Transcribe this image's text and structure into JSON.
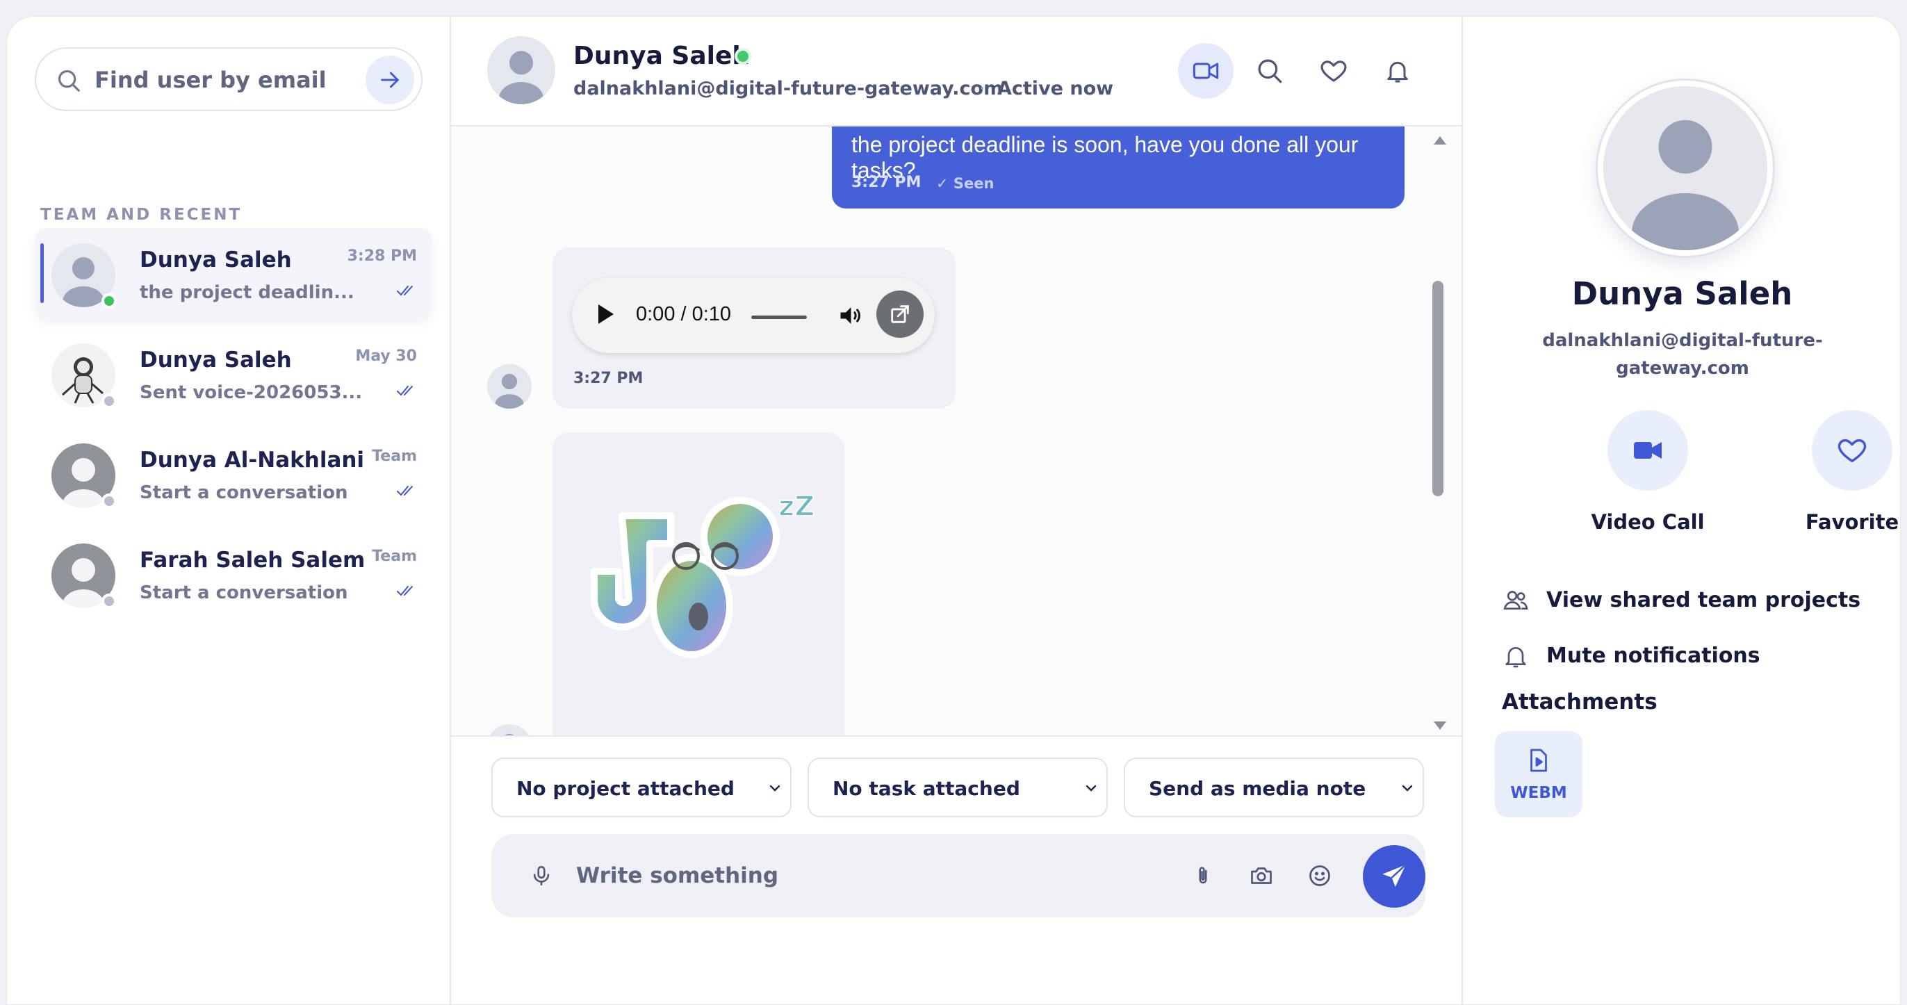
{
  "sidebar": {
    "search": {
      "placeholder": "Find user by email"
    },
    "section_label": "TEAM AND RECENT",
    "conversations": [
      {
        "name": "Dunya Saleh",
        "preview": "the project deadlin...",
        "time": "3:28 PM",
        "presence": "online",
        "avatar": "default-avatar",
        "active": true
      },
      {
        "name": "Dunya Saleh",
        "preview": "Sent voice-2026053...",
        "time": "May 30",
        "presence": "offline",
        "avatar": "photo-avatar",
        "active": false
      },
      {
        "name": "Dunya Al-Nakhlani",
        "preview": "Start a conversation",
        "time": "Team",
        "presence": "offline",
        "avatar": "default-avatar",
        "active": false
      },
      {
        "name": "Farah Saleh Salem",
        "preview": "Start a conversation",
        "time": "Team",
        "presence": "offline",
        "avatar": "default-avatar",
        "active": false
      }
    ]
  },
  "chat": {
    "header": {
      "name": "Dunya Saleh",
      "email": "dalnakhlani@digital-future-gateway.com",
      "separator": "·",
      "status": "Active now"
    },
    "messages": [
      {
        "direction": "out",
        "type": "text",
        "text": "the project deadline is soon, have you done all your tasks?",
        "time": "3:27 PM",
        "receipt": "Seen"
      },
      {
        "direction": "in",
        "type": "audio",
        "player_time": "0:00 / 0:10",
        "time": "3:27 PM"
      },
      {
        "direction": "in",
        "type": "sticker",
        "sticker": "sleepy-gear-sticker"
      }
    ],
    "composer": {
      "project_select": "No project attached",
      "task_select": "No task attached",
      "mode_select": "Send as media note",
      "input_placeholder": "Write something"
    }
  },
  "profile": {
    "name": "Dunya Saleh",
    "email_line1": "dalnakhlani@digital-future-",
    "email_line2": "gateway.com",
    "actions": {
      "video_call": "Video Call",
      "favorite": "Favorite"
    },
    "menu": {
      "shared_projects": "View shared team projects",
      "mute": "Mute notifications"
    },
    "attachments_title": "Attachments",
    "attachments": [
      {
        "type": "WEBM"
      }
    ]
  },
  "colors": {
    "accent": "#3d57d6",
    "online": "#3fc25b",
    "bubble_out": "#4660d8"
  }
}
